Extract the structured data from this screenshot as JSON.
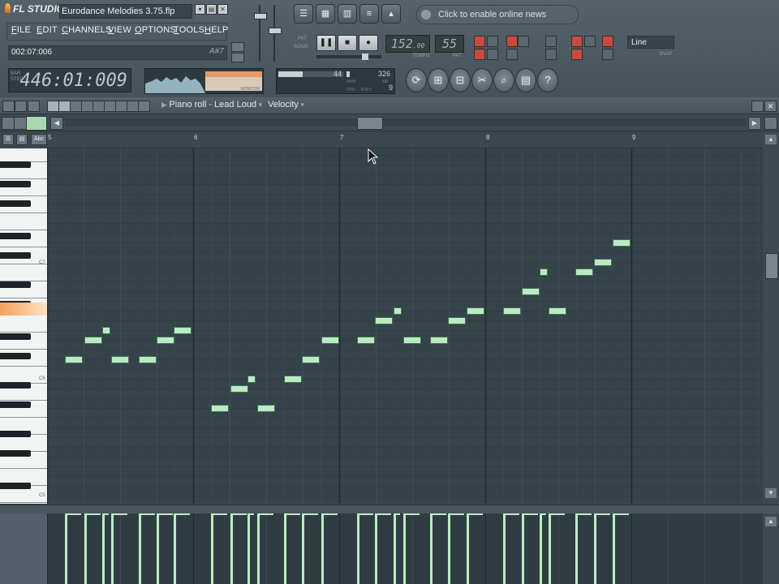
{
  "app": {
    "logo": "FL STUDIO",
    "project_title": "Eurodance Melodies 3.75.flp",
    "window_buttons": [
      "▾",
      "▤",
      "✕"
    ]
  },
  "menu": {
    "items": [
      "FILE",
      "EDIT",
      "CHANNELS",
      "VIEW",
      "OPTIONS",
      "TOOLS",
      "HELP"
    ]
  },
  "hint_bar": {
    "text": "002:07:006",
    "note": "A#7"
  },
  "song_position": {
    "text": "446:01:009",
    "labels": [
      "BAR",
      "STEP",
      "TICK"
    ]
  },
  "scope": {
    "label": "MONITOR"
  },
  "transport": {
    "pat_label": "PAT",
    "song_label": "SONG",
    "play": "❚❚",
    "stop": "■",
    "record": "●"
  },
  "tempo": {
    "value": "152",
    "decimal": ".00",
    "label": "TEMPO"
  },
  "pattern": {
    "value": "55",
    "label": "PAT"
  },
  "news": {
    "text": "Click to enable online news"
  },
  "snap": {
    "value": "Line",
    "label": "SNAP"
  },
  "meter": {
    "value_left": "44",
    "value_right": "326",
    "poly": "9",
    "ram_label": "RAM",
    "mb_label": "MB",
    "cpu_label": "CPU",
    "poly_label": "POLY"
  },
  "window_buttons_top": [
    "☰",
    "▦",
    "▥",
    "≡",
    "▴"
  ],
  "tool_icons": [
    "⟳",
    "⊞",
    "⊟",
    "✂",
    "⌕",
    "▤",
    "?"
  ],
  "piano_roll": {
    "title": "Piano roll - Lead Loud",
    "velocity_label": "Velocity",
    "bar_numbers": [
      "5",
      "6",
      "7",
      "8",
      "9"
    ],
    "octave_labels": [
      "C7",
      "C6",
      "C5"
    ]
  },
  "colors": {
    "note_fill": "#b8ecc3",
    "grid_bg": "#34444a",
    "highlight_key": "#f5a15a"
  }
}
